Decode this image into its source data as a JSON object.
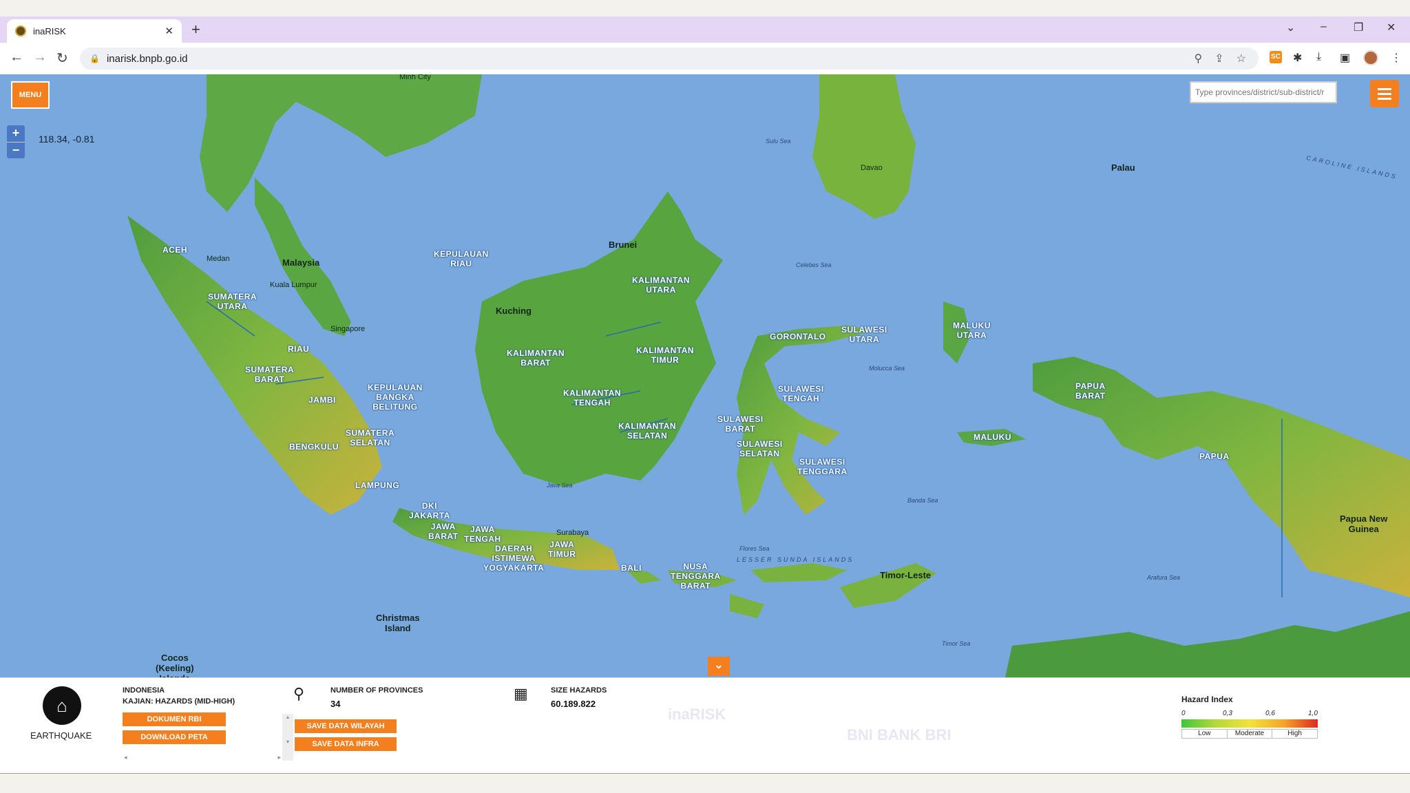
{
  "browser": {
    "tab_title": "inaRISK",
    "new_tab": "+",
    "tab_close": "✕",
    "url": "inarisk.bnpb.go.id",
    "extension_label": "SC"
  },
  "map": {
    "menu_label": "MENU",
    "zoom_in": "+",
    "zoom_out": "−",
    "coordinates": "118.34, -0.81",
    "search_placeholder": "Type provinces/district/sub-district/r",
    "collapse_icon": "chevrons-down-icon",
    "places": {
      "malaysia": "Malaysia",
      "kuala_lumpur": "Kuala Lumpur",
      "medan": "Medan",
      "singapore": "Singapore",
      "kuching": "Kuching",
      "brunei": "Brunei",
      "davao": "Davao",
      "palau": "Palau",
      "surabaya": "Surabaya",
      "christmas_island": "Christmas\nIsland",
      "cocos": "Cocos\n(Keeling)\nIslands",
      "timor_leste": "Timor-Leste",
      "png": "Papua New\nGuinea",
      "ho_chi_minh": "Minh City"
    },
    "provinces": {
      "aceh": "ACEH",
      "sumut": "SUMATERA\nUTARA",
      "riau": "RIAU",
      "sumbar": "SUMATERA\nBARAT",
      "jambi": "JAMBI",
      "babel": "KEPULAUAN\nBANGKA\nBELITUNG",
      "sumsel": "SUMATERA\nSELATAN",
      "bengkulu": "BENGKULU",
      "lampung": "LAMPUNG",
      "kepri": "KEPULAUAN\nRIAU",
      "kalbar": "KALIMANTAN\nBARAT",
      "kaltara": "KALIMANTAN\nUTARA",
      "kaltim": "KALIMANTAN\nTIMUR",
      "kalteng": "KALIMANTAN\nTENGAH",
      "kalsel": "KALIMANTAN\nSELATAN",
      "jakarta": "DKI\nJAKARTA",
      "jabar": "JAWA\nBARAT",
      "jateng": "JAWA\nTENGAH",
      "jatim": "JAWA\nTIMUR",
      "diy": "DAERAH\nISTIMEWA\nYOGYAKARTA",
      "bali": "BALI",
      "ntb": "NUSA\nTENGGARA\nBARAT",
      "gorontalo": "GORONTALO",
      "sulut": "SULAWESI\nUTARA",
      "sulbar": "SULAWESI\nBARAT",
      "sulteng": "SULAWESI\nTENGAH",
      "sulsel": "SULAWESI\nSELATAN",
      "sultra": "SULAWESI\nTENGGARA",
      "malut": "MALUKU\nUTARA",
      "maluku": "MALUKU",
      "papbar": "PAPUA\nBARAT",
      "papua": "PAPUA"
    },
    "seas": {
      "java_sea": "Java Sea",
      "celebes_sea": "Celebes Sea",
      "sulu_sea": "Sulu Sea",
      "banda_sea": "Banda Sea",
      "flores_sea": "Flores Sea",
      "molucca_sea": "Molucca Sea",
      "timor_sea": "Timor Sea",
      "arafura_sea": "Arafura Sea",
      "caroline": "CAROLINE ISLANDS",
      "lesser_sunda": "LESSER SUNDA ISLANDS"
    }
  },
  "panel": {
    "hazard_icon": "earthquake-icon",
    "hazard_label": "EARTHQUAKE",
    "region": "INDONESIA",
    "study": "KAJIAN: HAZARDS (MID-HIGH)",
    "btn_dokumen": "DOKUMEN RBI",
    "btn_download": "DOWNLOAD PETA",
    "btn_save_wilayah": "SAVE DATA WILAYAH",
    "btn_save_infra": "SAVE DATA INFRA",
    "provinces_title": "NUMBER OF PROVINCES",
    "provinces_value": "34",
    "size_title": "SIZE HAZARDS",
    "size_value": "60.189.822",
    "faded_brand": "inaRISK",
    "faded_partners": "BNI     BANK BRI"
  },
  "legend": {
    "title": "Hazard Index",
    "ticks": [
      "0",
      "0,3",
      "0,6",
      "1,0"
    ],
    "categories": [
      "Low",
      "Moderate",
      "High"
    ]
  },
  "colors": {
    "accent": "#f47f1e",
    "sea": "#78a8de",
    "land": "#4c9a3e"
  }
}
